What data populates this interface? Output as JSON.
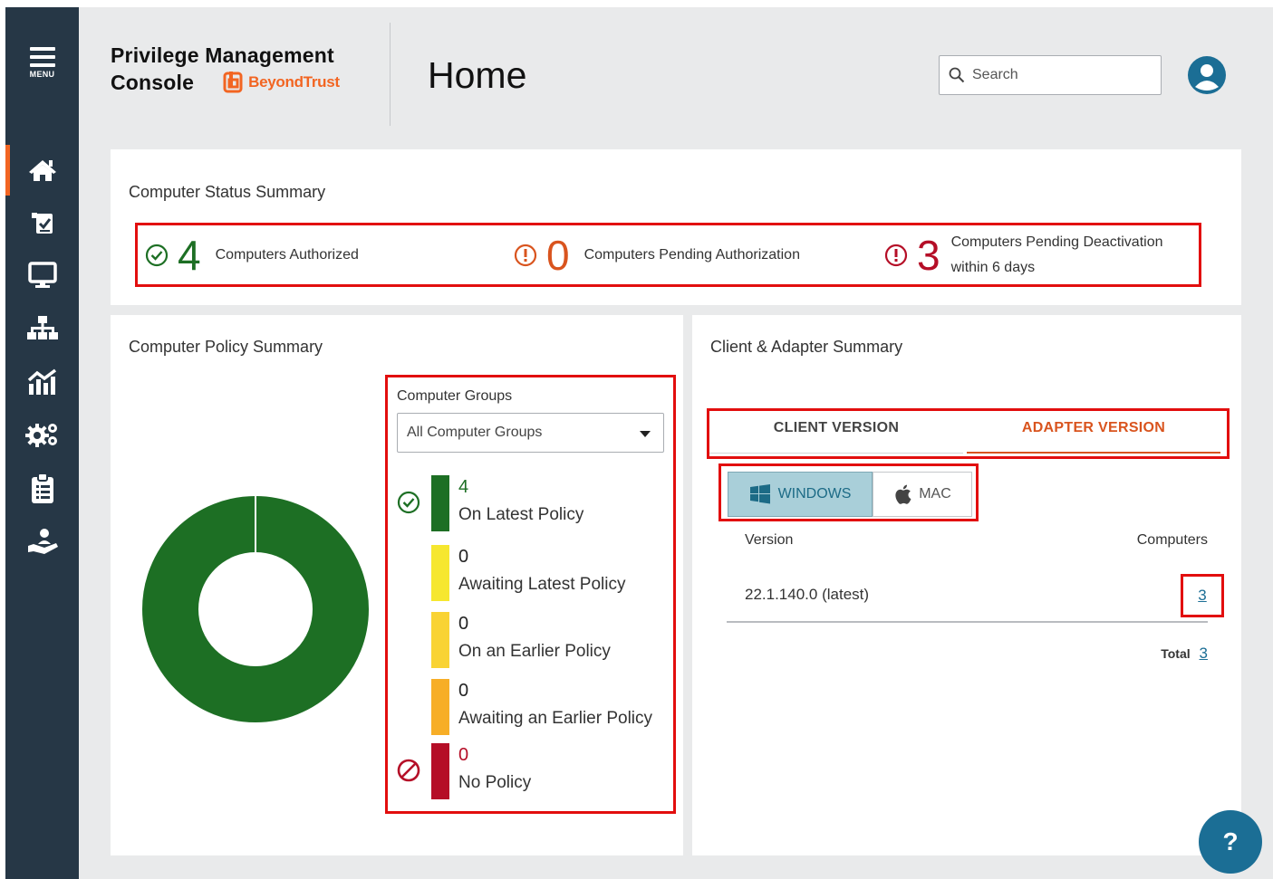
{
  "app": {
    "brand_line1": "Privilege Management",
    "brand_line2": "Console",
    "logo_text": "BeyondTrust",
    "page_title": "Home",
    "menu_label": "MENU"
  },
  "sidebar": {
    "items": [
      {
        "icon": "home-icon",
        "active": true
      },
      {
        "icon": "policy-icon",
        "active": false
      },
      {
        "icon": "computer-icon",
        "active": false
      },
      {
        "icon": "hierarchy-icon",
        "active": false
      },
      {
        "icon": "analytics-icon",
        "active": false
      },
      {
        "icon": "settings-gears-icon",
        "active": false
      },
      {
        "icon": "clipboard-icon",
        "active": false
      },
      {
        "icon": "hand-user-icon",
        "active": false
      }
    ]
  },
  "search": {
    "placeholder": "Search"
  },
  "status_summary": {
    "title": "Computer Status Summary",
    "authorized": {
      "count": "4",
      "label": "Computers Authorized"
    },
    "pending_auth": {
      "count": "0",
      "label": "Computers Pending Authorization"
    },
    "pending_deact": {
      "count": "3",
      "label_line1": "Computers Pending Deactivation",
      "label_line2": "within 6 days"
    }
  },
  "policy_summary": {
    "title": "Computer Policy Summary",
    "groups_label": "Computer Groups",
    "groups_selected": "All Computer Groups",
    "items": [
      {
        "value": "4",
        "label": "On Latest Policy",
        "color": "#1d6f24"
      },
      {
        "value": "0",
        "label": "Awaiting Latest Policy",
        "color": "#f6e72f"
      },
      {
        "value": "0",
        "label": "On an Earlier Policy",
        "color": "#f9d334"
      },
      {
        "value": "0",
        "label": "Awaiting an Earlier Policy",
        "color": "#f7ae27"
      },
      {
        "value": "0",
        "label": "No Policy",
        "color": "#b50e27"
      }
    ]
  },
  "client_summary": {
    "title": "Client & Adapter Summary",
    "tabs": [
      "CLIENT VERSION",
      "ADAPTER VERSION"
    ],
    "active_tab": "ADAPTER VERSION",
    "os_buttons": [
      "WINDOWS",
      "MAC"
    ],
    "active_os": "WINDOWS",
    "col_version": "Version",
    "col_computers": "Computers",
    "rows": [
      {
        "version": "22.1.140.0 (latest)",
        "computers": "3"
      }
    ],
    "total_label": "Total",
    "total_value": "3"
  },
  "help": {
    "label": "?"
  },
  "colors": {
    "accent": "#f26522",
    "sidebar": "#263746",
    "link": "#1b6e95",
    "highlight": "#e20e0e",
    "success": "#1d6f24",
    "danger": "#b50e27"
  }
}
